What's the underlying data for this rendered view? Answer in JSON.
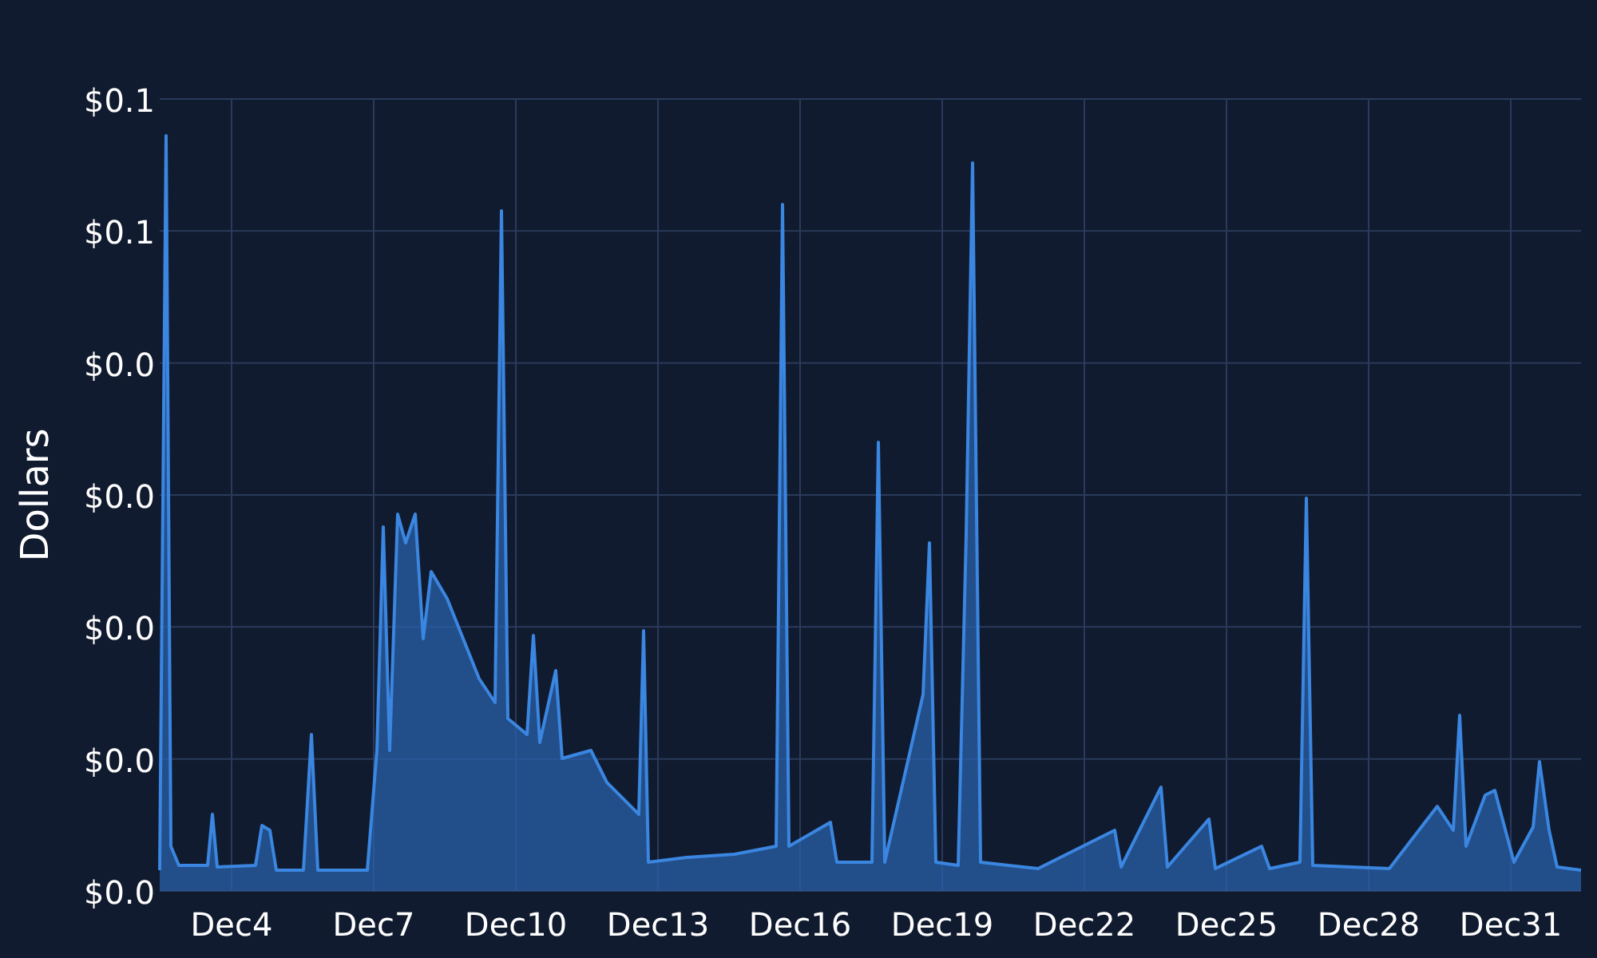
{
  "chart": {
    "y_axis_title": "Dollars",
    "y_axis_labels": [
      "$0.1",
      "$0.1",
      "$0.0",
      "$0.0",
      "$0.0",
      "$0.0",
      "$0.0"
    ],
    "x_axis_labels": [
      "Dec4",
      "Dec7",
      "Dec10",
      "Dec13",
      "Dec16",
      "Dec19",
      "Dec22",
      "Dec25",
      "Dec28",
      "Dec31"
    ]
  }
}
